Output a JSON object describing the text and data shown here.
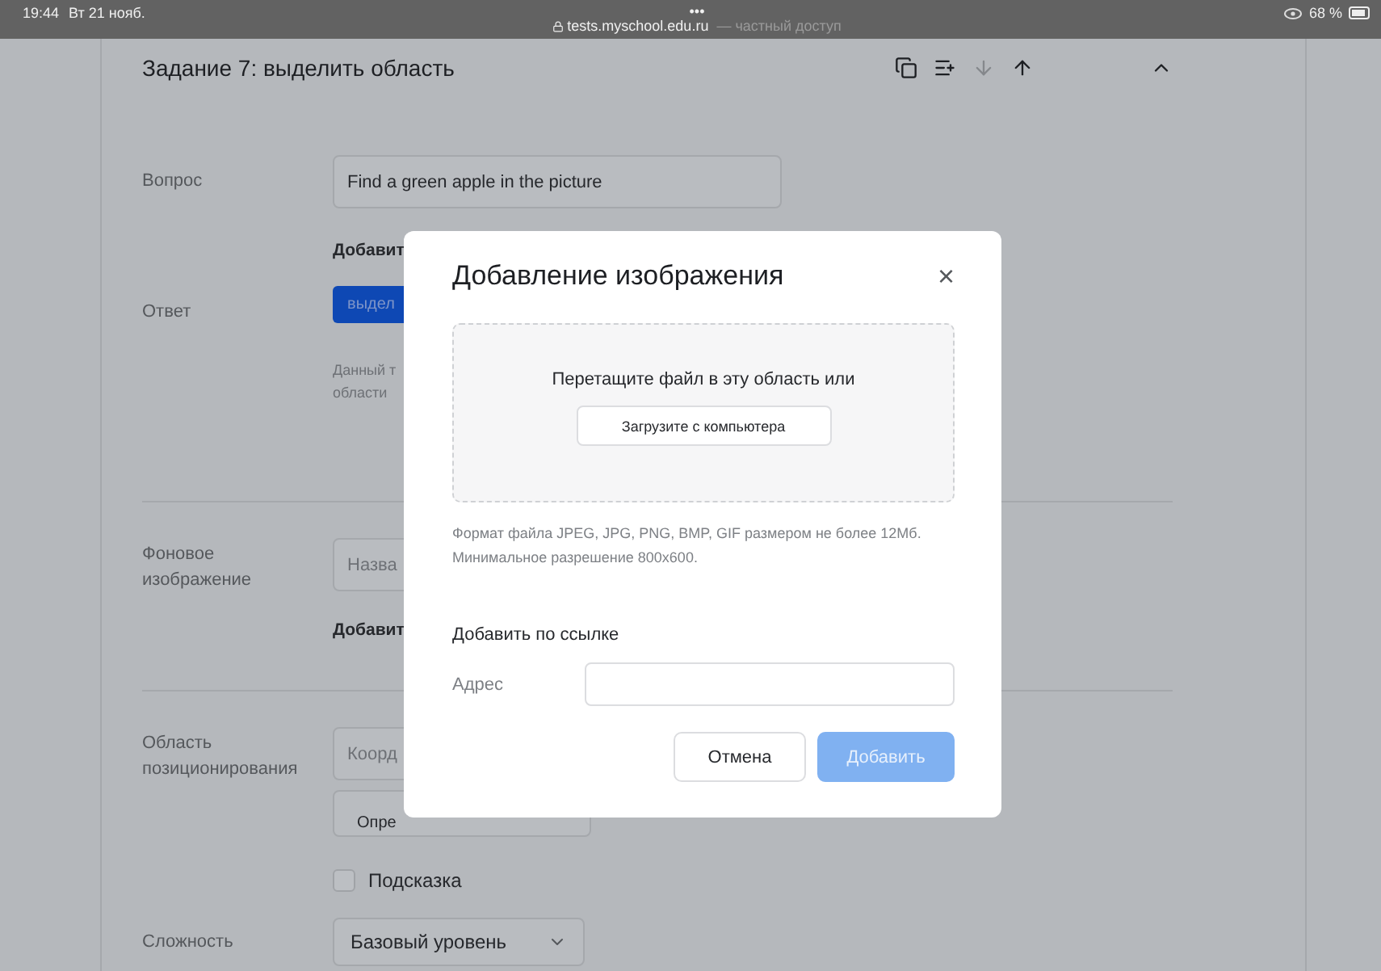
{
  "status_bar": {
    "time": "19:44",
    "date": "Вт 21 нояб.",
    "dots": "•••",
    "url": "tests.myschool.edu.ru",
    "url_note": "— частный доступ",
    "battery": "68 %"
  },
  "task": {
    "title": "Задание 7: выделить область",
    "expanded": true,
    "toolbar": [
      {
        "kind": "copy",
        "disabled": false
      },
      {
        "kind": "list",
        "disabled": false
      },
      {
        "kind": "down",
        "disabled": true
      },
      {
        "kind": "up",
        "disabled": false
      }
    ]
  },
  "question": {
    "label": "Вопрос",
    "value": "Find a green apple in the picture",
    "link": "Добавит"
  },
  "answer": {
    "label": "Ответ",
    "button": "выдел",
    "hint_lines": [
      "Данный т",
      "области"
    ]
  },
  "background": {
    "label": "Фоновое изображение",
    "placeholder": "Назва",
    "link": "Добавит"
  },
  "position": {
    "label": "Область позиционирования",
    "placeholder": "Коорд",
    "button": "Опре",
    "hint": {
      "label": "Подсказка",
      "checked": false
    }
  },
  "difficulty": {
    "label": "Сложность",
    "value": "Базовый уровень"
  },
  "dialog": {
    "title": "Добавление изображения",
    "close": "×",
    "drop_text": "Перетащите файл в эту область или",
    "upload_button": "Загрузите с компьютера",
    "format_note": "Формат файла JPEG, JPG, PNG, BMP, GIF размером не более 12Мб. Минимальное разрешение 800x600.",
    "link_heading": "Добавить по ссылке",
    "address_label": "Адрес",
    "buttons": [
      {
        "label": "Отмена",
        "kind": "secondary"
      },
      {
        "label": "Добавить",
        "kind": "primary",
        "disabled": true
      }
    ]
  }
}
